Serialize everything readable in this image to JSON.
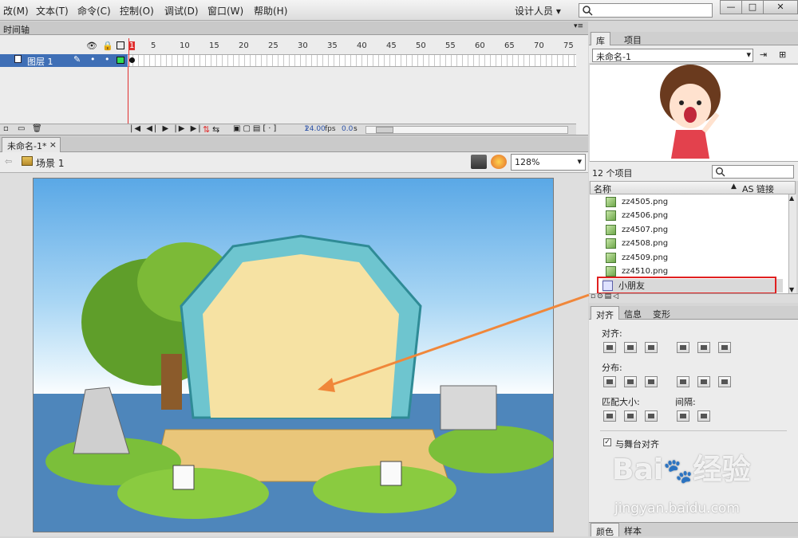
{
  "menu": [
    "改(M)",
    "文本(T)",
    "命令(C)",
    "控制(O)",
    "调试(D)",
    "窗口(W)",
    "帮助(H)"
  ],
  "workspace_label": "设计人员",
  "window_buttons": [
    "—",
    "□",
    "✕"
  ],
  "timeline": {
    "tab_label": "时间轴",
    "layer_name": "图层 1",
    "frame_ticks": [
      "1",
      "5",
      "10",
      "15",
      "20",
      "25",
      "30",
      "35",
      "40",
      "45",
      "50",
      "55",
      "60",
      "65",
      "70",
      "75"
    ],
    "current_frame": "1",
    "fps": "24.00",
    "fps_unit": "fps",
    "time": "0.0",
    "time_unit": "s"
  },
  "document": {
    "tab_label": "未命名-1*",
    "close_glyph": "×",
    "scene_label": "场景 1",
    "zoom": "128%"
  },
  "library": {
    "tab_library": "库",
    "tab_project": "项目",
    "doc_name": "未命名-1",
    "item_count": "12 个项目",
    "col_name": "名称",
    "col_link": "AS 链接",
    "items": [
      "zz4505.png",
      "zz4506.png",
      "zz4507.png",
      "zz4508.png",
      "zz4509.png",
      "zz4510.png"
    ],
    "selected_item": "小朋友"
  },
  "align_panel": {
    "tabs": [
      "对齐",
      "信息",
      "变形"
    ],
    "align_label": "对齐:",
    "distribute_label": "分布:",
    "match_size_label": "匹配大小:",
    "spacing_label": "间隔:",
    "align_to_stage": "与舞台对齐",
    "align_to_stage_checked": true
  },
  "bottom_tabs": [
    "颜色",
    "样本"
  ],
  "watermark": {
    "brand": "Bai",
    "brand2": "经验",
    "url": "jingyan.baidu.com"
  },
  "colors": {
    "accent_layer": "#3f6fb6",
    "playhead": "#e03030",
    "arrow": "#f0873a",
    "highlight": "#e02020"
  }
}
